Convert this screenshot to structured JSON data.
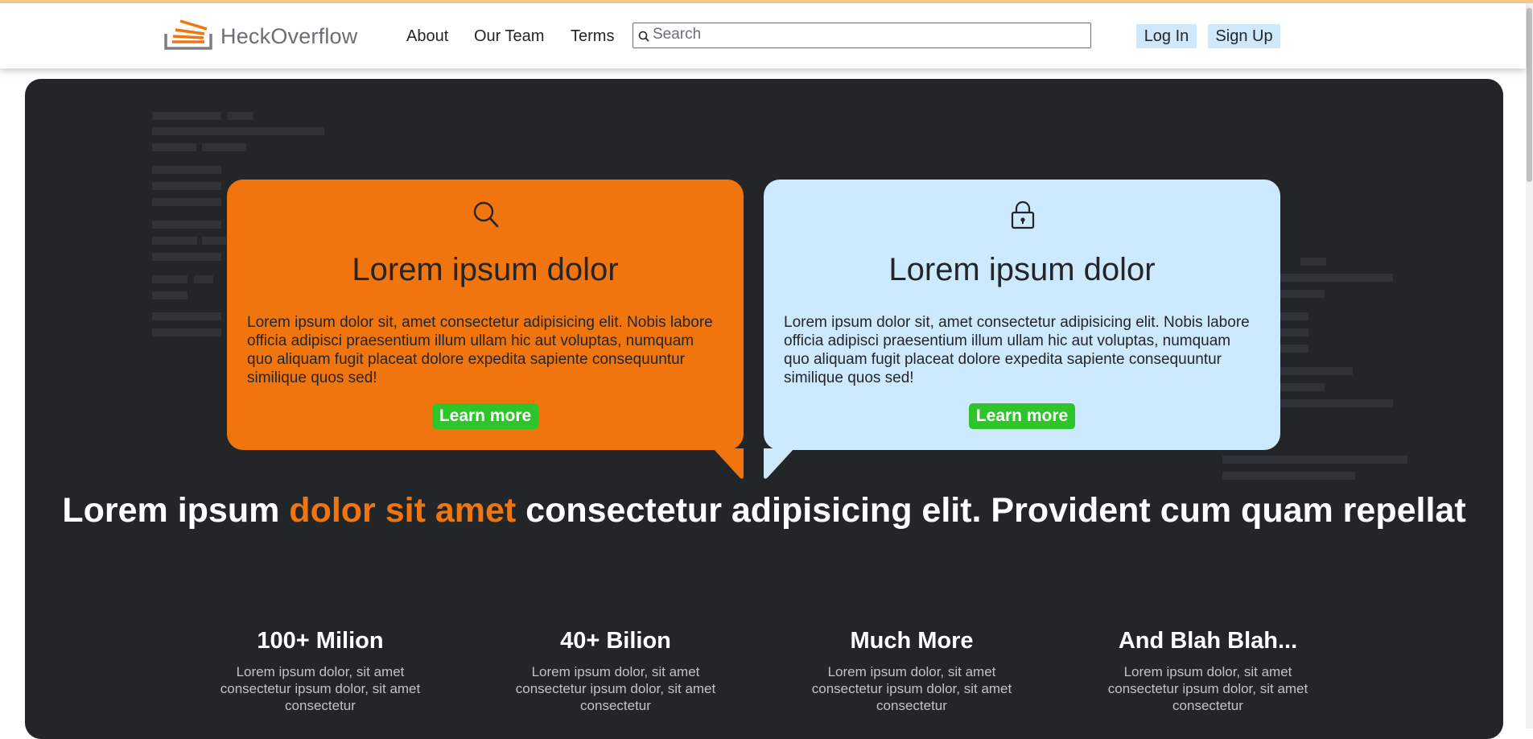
{
  "brand": {
    "name": "HeckOverflow",
    "accent": "#f0750f"
  },
  "nav": {
    "links": [
      "About",
      "Our Team",
      "Terms"
    ]
  },
  "search": {
    "placeholder": "Search",
    "value": ""
  },
  "auth": {
    "login_label": "Log In",
    "signup_label": "Sign Up"
  },
  "cards": [
    {
      "icon": "search-icon",
      "title": "Lorem ipsum dolor",
      "text": "Lorem ipsum dolor sit, amet consectetur adipisicing elit. Nobis labore officia adipisci praesentium illum ullam hic aut voluptas, numquam quo aliquam fugit placeat dolore expedita sapiente consequuntur similique quos sed!",
      "button": "Learn more",
      "color": "#f0750f"
    },
    {
      "icon": "lock-icon",
      "title": "Lorem ipsum dolor",
      "text": "Lorem ipsum dolor sit, amet consectetur adipisicing elit. Nobis labore officia adipisci praesentium illum ullam hic aut voluptas, numquam quo aliquam fugit placeat dolore expedita sapiente consequuntur similique quos sed!",
      "button": "Learn more",
      "color": "#cde9fd"
    }
  ],
  "headline": {
    "before": "Lorem ipsum ",
    "accent": "dolor sit amet",
    "after": " consectetur adipisicing elit. Provident cum quam repellat"
  },
  "stats": [
    {
      "title": "100+ Milion",
      "text": "Lorem ipsum dolor, sit amet consectetur ipsum dolor, sit amet consectetur"
    },
    {
      "title": "40+ Bilion",
      "text": "Lorem ipsum dolor, sit amet consectetur ipsum dolor, sit amet consectetur"
    },
    {
      "title": "Much More",
      "text": "Lorem ipsum dolor, sit amet consectetur ipsum dolor, sit amet consectetur"
    },
    {
      "title": "And Blah Blah...",
      "text": "Lorem ipsum dolor, sit amet consectetur ipsum dolor, sit amet consectetur"
    }
  ],
  "colors": {
    "hero_bg": "#232629",
    "button_green": "#2ec52b",
    "auth_button_bg": "#cfe8fb"
  }
}
